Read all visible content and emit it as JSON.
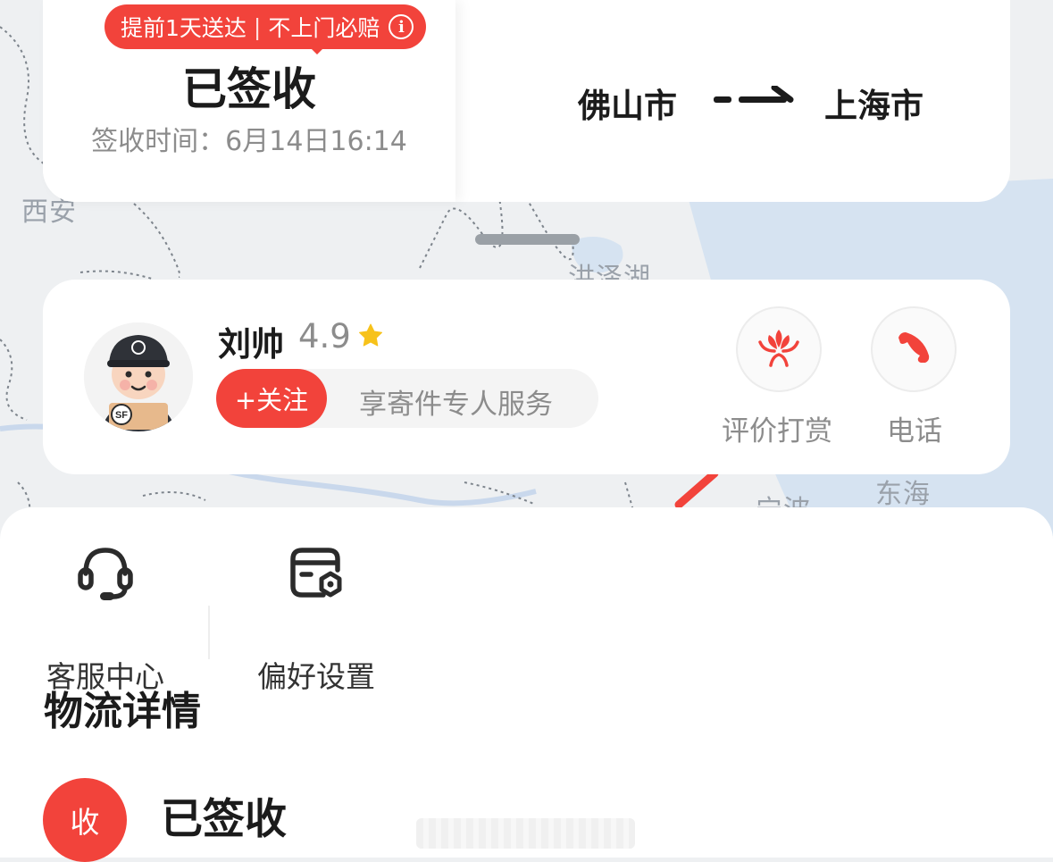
{
  "map": {
    "labels": {
      "xian": "西安",
      "hongze_lake": "洪泽湖",
      "ningbo": "宁波",
      "donghai": "东海"
    },
    "route_color": "#f2433b"
  },
  "status_card": {
    "promo_badge": {
      "fast_text": "提前1天送达",
      "separator": "|",
      "guarantee_text": "不上门必赔",
      "info_icon": "info-icon",
      "info_glyph": "i"
    },
    "status": "已签收",
    "signed_time": "签收时间：6月14日16:14",
    "from_city": "佛山市",
    "to_city": "上海市",
    "route_icon": "route-arrow-icon"
  },
  "courier": {
    "name": "刘帅",
    "rating": "4.9",
    "rating_icon": "star-icon",
    "avatar_badge": "SF",
    "follow_label": "+关注",
    "service_text": "享寄件专人服务",
    "actions": {
      "reward": {
        "label": "评价打赏",
        "icon": "lotus-reward-icon"
      },
      "phone": {
        "label": "电话",
        "icon": "phone-icon"
      }
    }
  },
  "quick_actions": {
    "service_center": {
      "label": "客服中心",
      "icon": "headset-icon"
    },
    "preferences": {
      "label": "偏好设置",
      "icon": "settings-card-icon"
    }
  },
  "logistics": {
    "title": "物流详情",
    "timeline": [
      {
        "badge": "收",
        "status": "已签收"
      }
    ]
  },
  "colors": {
    "accent": "#f2433b",
    "star": "#f7c21a",
    "text_primary": "#1b1b1b",
    "text_secondary": "#8c8c8c"
  }
}
